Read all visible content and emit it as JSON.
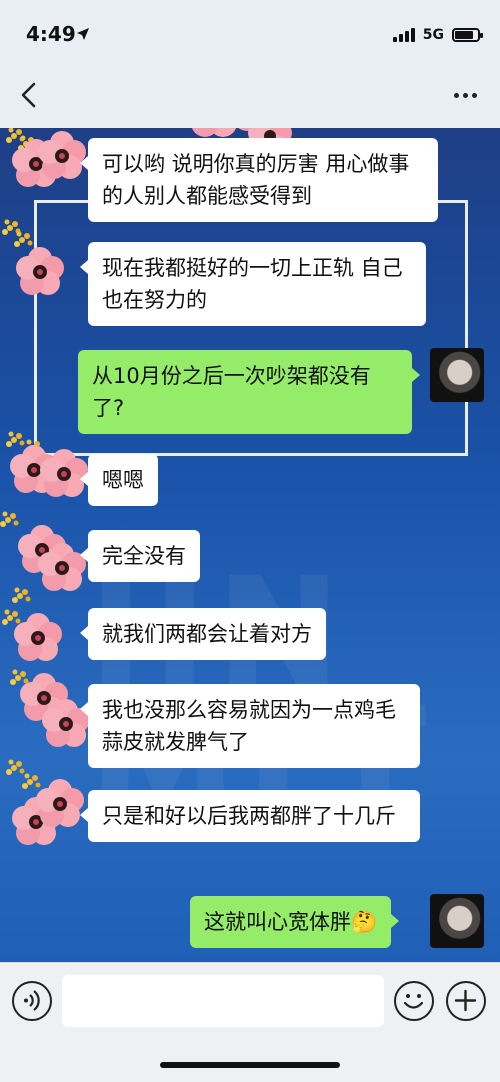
{
  "status_bar": {
    "time": "4:49",
    "network": "5G"
  },
  "messages": [
    {
      "side": "in",
      "text": "可以哟 说明你真的厉害  用心做事的人别人都能感受得到"
    },
    {
      "side": "in",
      "text": "现在我都挺好的一切上正轨 自己也在努力的"
    },
    {
      "side": "out",
      "text": "从10月份之后一次吵架都没有了?"
    },
    {
      "side": "in",
      "text": "嗯嗯"
    },
    {
      "side": "in",
      "text": "完全没有"
    },
    {
      "side": "in",
      "text": "就我们两都会让着对方"
    },
    {
      "side": "in",
      "text": "我也没那么容易就因为一点鸡毛蒜皮就发脾气了"
    },
    {
      "side": "in",
      "text": "只是和好以后我两都胖了十几斤"
    },
    {
      "side": "out",
      "text": "这就叫心宽体胖",
      "emoji": "🤔"
    }
  ],
  "colors": {
    "incoming_bubble": "#ffffff",
    "outgoing_bubble": "#95ec69",
    "chat_background": "#1e4e9e"
  },
  "icons": {
    "back": "chevron-left-icon",
    "more": "more-dots-icon",
    "voice": "voice-icon",
    "emoji": "emoji-icon",
    "plus": "plus-icon"
  }
}
